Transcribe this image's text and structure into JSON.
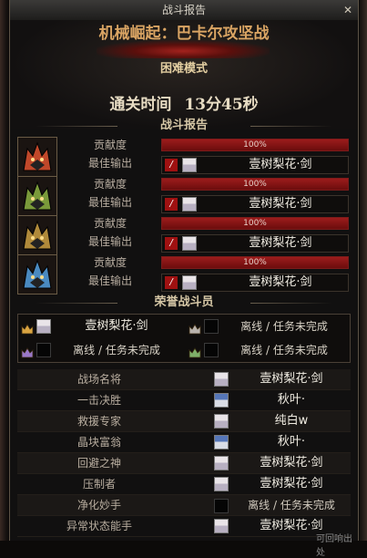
{
  "window": {
    "title": "战斗报告",
    "close": "✕"
  },
  "dungeon": {
    "name": "机械崛起：巴卡尔攻坚战",
    "mode": "困难模式"
  },
  "clear": {
    "label": "通关时间",
    "time": "13分45秒"
  },
  "sections": {
    "report": "战斗报告",
    "honor": "荣誉战斗员"
  },
  "roles": [
    {
      "icon": "bakal-red-dragon-icon",
      "accent": "#c0482a",
      "contribution_label": "贡献度",
      "contribution_value": "100%",
      "fill": 1.0,
      "best_label": "最佳输出",
      "player": "壹树梨花·剑"
    },
    {
      "icon": "bakal-green-dragon-icon",
      "accent": "#7a9a3a",
      "contribution_label": "贡献度",
      "contribution_value": "100%",
      "fill": 1.0,
      "best_label": "最佳输出",
      "player": "壹树梨花·剑"
    },
    {
      "icon": "bakal-gold-dragon-icon",
      "accent": "#b08a3a",
      "contribution_label": "贡献度",
      "contribution_value": "100%",
      "fill": 1.0,
      "best_label": "最佳输出",
      "player": "壹树梨花·剑"
    },
    {
      "icon": "bakal-blue-dragon-icon",
      "accent": "#4a8ac0",
      "contribution_label": "贡献度",
      "contribution_value": "100%",
      "fill": 1.0,
      "best_label": "最佳输出",
      "player": "壹树梨花·剑"
    }
  ],
  "honor": [
    {
      "crown": "gold-crown-icon",
      "crown_color": "#d9a441",
      "name": "壹树梨花·剑",
      "present": true
    },
    {
      "crown": "red-crown-icon",
      "crown_color": "#b9b3ad",
      "name": "离线 / 任务未完成",
      "present": false
    },
    {
      "crown": "purple-crown-icon",
      "crown_color": "#9a78c8",
      "name": "离线 / 任务未完成",
      "present": false
    },
    {
      "crown": "green-crown-icon",
      "crown_color": "#7fb06a",
      "name": "离线 / 任务未完成",
      "present": false
    }
  ],
  "awards": [
    {
      "label": "战场名将",
      "name": "壹树梨花·剑",
      "avatar": "light"
    },
    {
      "label": "一击决胜",
      "name": "秋叶·",
      "avatar": "blue"
    },
    {
      "label": "救援专家",
      "name": "纯白w",
      "avatar": "light"
    },
    {
      "label": "晶块富翁",
      "name": "秋叶·",
      "avatar": "blue"
    },
    {
      "label": "回避之神",
      "name": "壹树梨花·剑",
      "avatar": "light"
    },
    {
      "label": "压制者",
      "name": "壹树梨花·剑",
      "avatar": "light"
    },
    {
      "label": "净化妙手",
      "name": "离线 / 任务未完成",
      "avatar": "none"
    },
    {
      "label": "异常状态能手",
      "name": "壹树梨花·剑",
      "avatar": "light"
    }
  ],
  "footer": {
    "link": "可回响出处"
  }
}
